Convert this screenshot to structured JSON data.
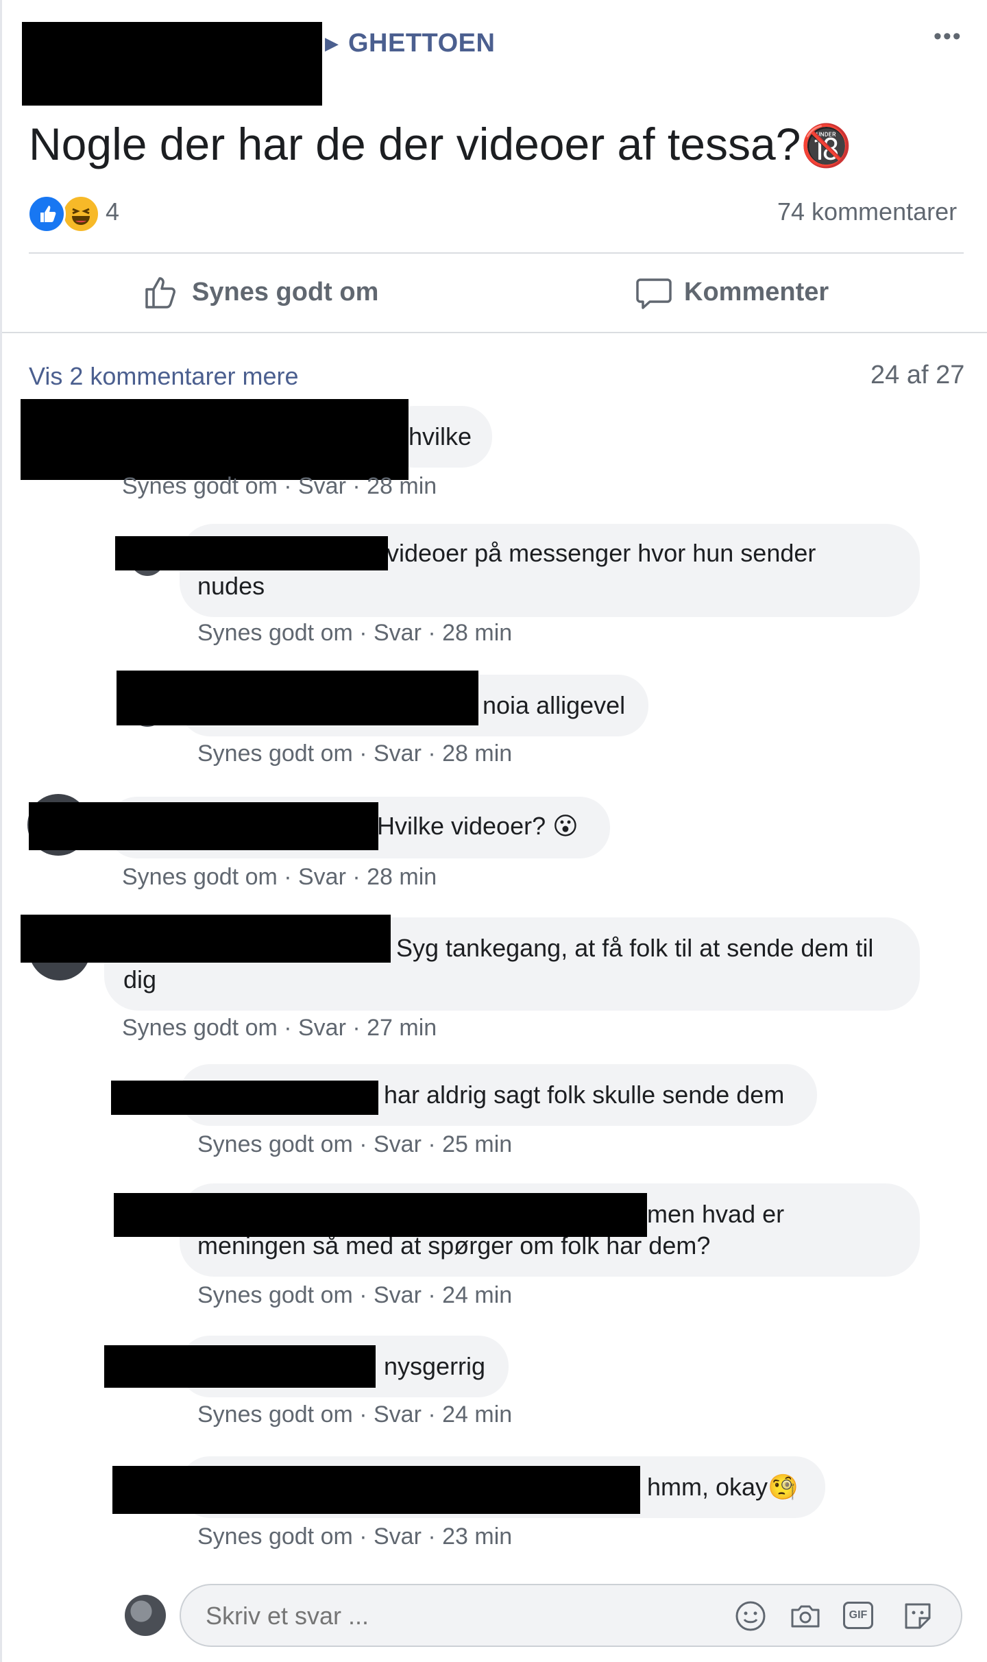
{
  "post": {
    "group_arrow": "▶",
    "group_name": "GHETTOEN",
    "more_label": "•••",
    "title": "Nogle der har de der videoer af tessa?",
    "title_emoji": "🔞",
    "reaction_count": "4",
    "comment_count": "74 kommentarer",
    "reactions": [
      "like-icon",
      "haha-icon"
    ]
  },
  "actions": {
    "like_label": "Synes godt om",
    "comment_label": "Kommenter"
  },
  "comments_header": {
    "more_comments": "Vis 2 kommentarer mere",
    "pager": "24 af 27"
  },
  "comments": [
    {
      "line1": "hvilke",
      "line2": "",
      "meta": "Synes godt om · Svar · 28 min"
    },
    {
      "line1": "videoer på messenger hvor hun sender",
      "line2": "nudes",
      "meta": "Synes godt om · Svar · 28 min"
    },
    {
      "line1": "noia alligevel",
      "line2": "",
      "meta": "Synes godt om · Svar · 28 min"
    },
    {
      "line1": "Hvilke videoer? 😮",
      "line2": "",
      "meta": "Synes godt om · Svar · 28 min"
    },
    {
      "line1": "Syg tankegang, at få folk til at sende dem til",
      "line2": "dig",
      "meta": "Synes godt om · Svar · 27 min"
    },
    {
      "line1": "har aldrig sagt folk skulle sende dem",
      "line2": "",
      "meta": "Synes godt om · Svar · 25 min"
    },
    {
      "line1": "men hvad er",
      "line2": "meningen så med at spørger om folk har dem?",
      "meta": "Synes godt om · Svar · 24 min"
    },
    {
      "line1": "nysgerrig",
      "line2": "",
      "meta": "Synes godt om · Svar · 24 min"
    },
    {
      "line1": "hmm, okay🧐",
      "line2": "",
      "meta": "Synes godt om · Svar · 23 min"
    }
  ],
  "reply_box": {
    "placeholder": "Skriv et svar ...",
    "icons": [
      "emoji-icon",
      "camera-icon",
      "gif-icon",
      "sticker-icon"
    ],
    "gif_label": "GIF"
  },
  "colors": {
    "accent": "#4b5f8f",
    "bubble": "#f2f3f5",
    "muted": "#606770",
    "like_blue": "#1877f2",
    "haha_yellow": "#f7b928"
  }
}
